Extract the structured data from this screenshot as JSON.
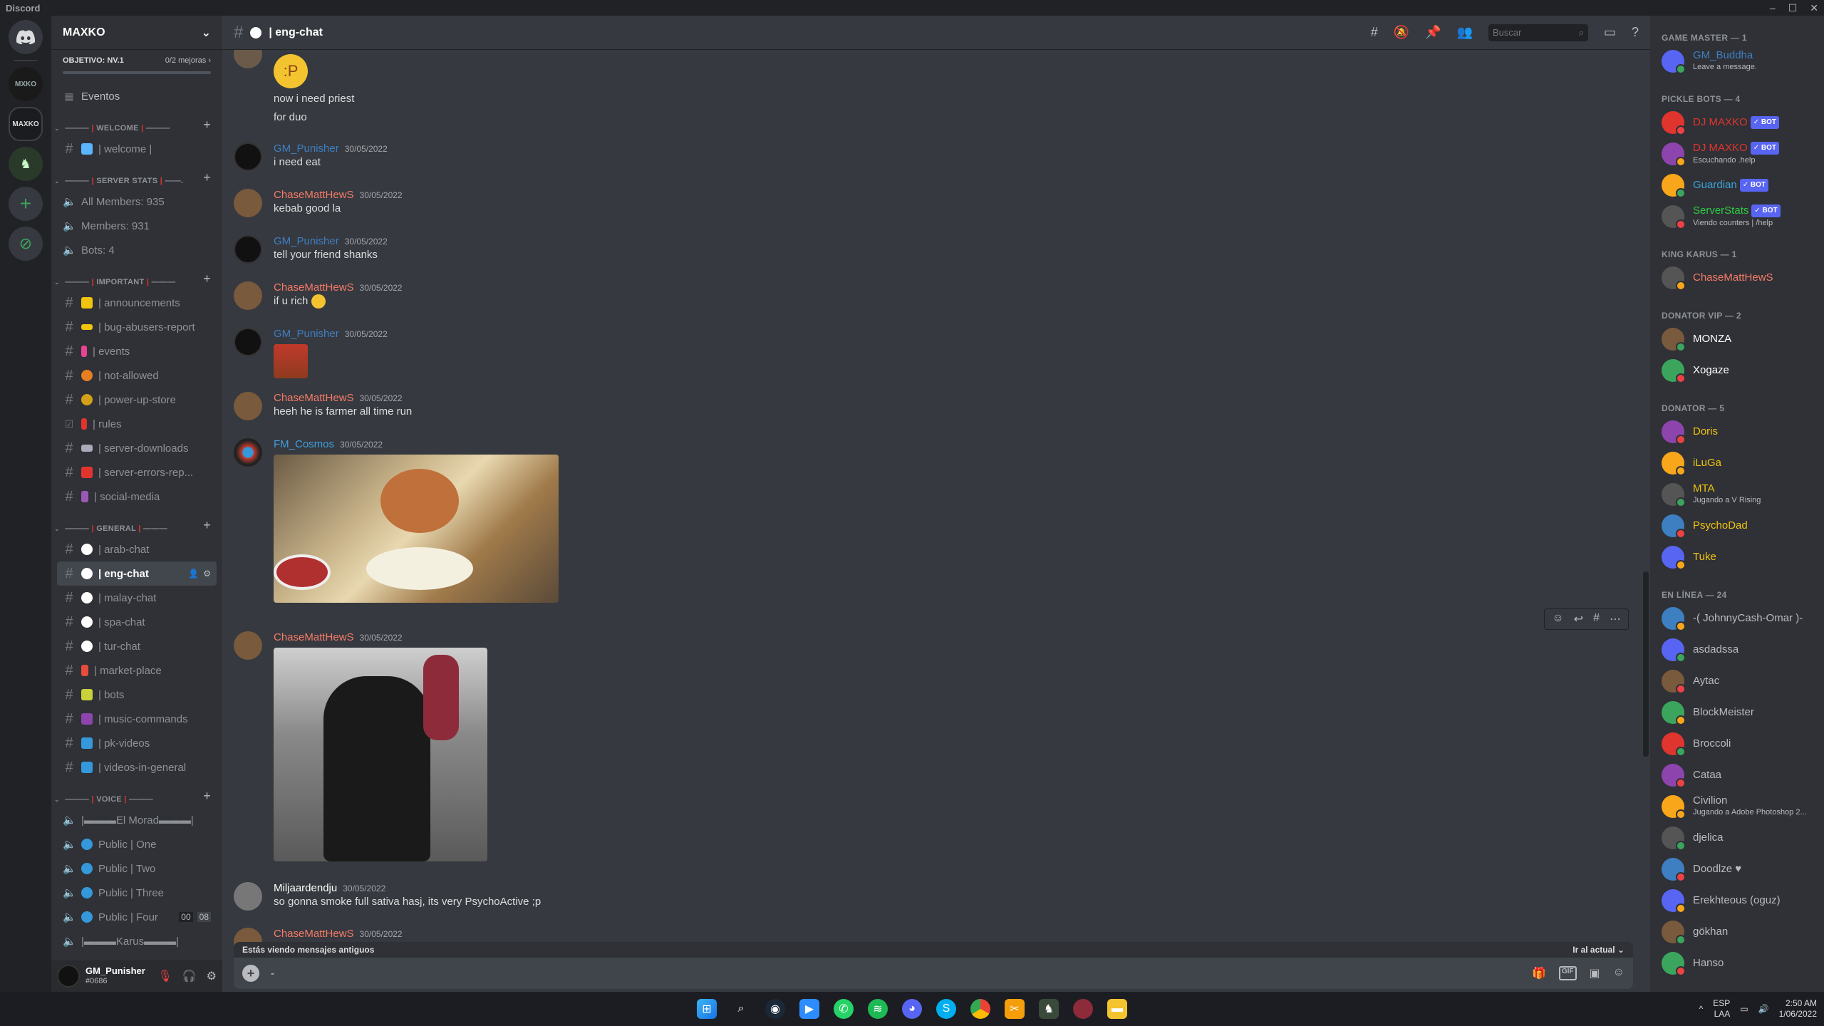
{
  "app": {
    "name": "Discord"
  },
  "server": {
    "name": "MAXKO",
    "boost_goal": "OBJETIVO: NV.1",
    "boost_progress": "0/2 mejoras",
    "boost_fraction": 0.0,
    "events_label": "Eventos"
  },
  "categories": {
    "welcome": "WELCOME",
    "server_stats": "SERVER STATS",
    "important": "IMPORTANT",
    "general": "GENERAL",
    "voice": "VOICE"
  },
  "channels": {
    "welcome": [
      "| welcome |"
    ],
    "server_stats": [
      "All Members: 935",
      "Members: 931",
      "Bots: 4"
    ],
    "important": [
      "| announcements",
      "| bug-abusers-report",
      "| events",
      "| not-allowed",
      "| power-up-store",
      "| rules",
      "| server-downloads",
      "| server-errors-rep...",
      "| social-media"
    ],
    "general": [
      "| arab-chat",
      "| eng-chat",
      "| malay-chat",
      "| spa-chat",
      "| tur-chat",
      "| market-place",
      "| bots",
      "| music-commands",
      "| pk-videos",
      "| videos-in-general"
    ],
    "voice": [
      "|▬▬▬El Morad▬▬▬|",
      "Public | One",
      "Public | Two",
      "Public | Three",
      "Public | Four",
      "|▬▬▬Karus▬▬▬|"
    ],
    "voice_four_counts": [
      "00",
      "08"
    ]
  },
  "user": {
    "name": "GM_Punisher",
    "tag": "#0686"
  },
  "channel_header": {
    "title": "| eng-chat",
    "search_placeholder": "Buscar"
  },
  "messages": {
    "top_lines": [
      "now i need priest",
      "for duo"
    ],
    "m1": {
      "author": "GM_Punisher",
      "time": "30/05/2022",
      "text": "i need eat"
    },
    "m2": {
      "author": "ChaseMattHewS",
      "time": "30/05/2022",
      "text": "kebab good la"
    },
    "m3": {
      "author": "GM_Punisher",
      "time": "30/05/2022",
      "text": "tell your friend shanks"
    },
    "m4": {
      "author": "ChaseMattHewS",
      "time": "30/05/2022",
      "text": "if u rich"
    },
    "m5": {
      "author": "GM_Punisher",
      "time": "30/05/2022"
    },
    "m6": {
      "author": "ChaseMattHewS",
      "time": "30/05/2022",
      "text": "heeh he is farmer all time run"
    },
    "m7": {
      "author": "FM_Cosmos",
      "time": "30/05/2022"
    },
    "m8": {
      "author": "ChaseMattHewS",
      "time": "30/05/2022"
    },
    "m9": {
      "author": "Miljaardendju",
      "time": "30/05/2022",
      "text": "so gonna smoke full sativa hasj, its very PsychoActive ;p"
    },
    "m10": {
      "author": "ChaseMattHewS",
      "time": "30/05/2022"
    }
  },
  "old_messages_bar": {
    "text": "Estás viendo mensajes antiguos",
    "jump": "Ir al actual"
  },
  "composer": {
    "value": "-"
  },
  "member_list": {
    "groups": [
      {
        "title": "GAME MASTER — 1",
        "members": [
          {
            "name": "GM_Buddha",
            "status": "Leave a message.",
            "color": "#3e7fc1",
            "bot": false
          }
        ]
      },
      {
        "title": "PICKLE BOTS — 4",
        "members": [
          {
            "name": "DJ MAXKO",
            "status": "",
            "color": "#e0342f",
            "bot": true
          },
          {
            "name": "DJ MAXKO",
            "status": "Escuchando .help",
            "color": "#e0342f",
            "bot": true
          },
          {
            "name": "Guardian",
            "status": "",
            "color": "#3ba5dc",
            "bot": true
          },
          {
            "name": "ServerStats",
            "status": "Viendo counters | /help",
            "color": "#2ecc40",
            "bot": true
          }
        ]
      },
      {
        "title": "KING KARUS — 1",
        "members": [
          {
            "name": "ChaseMattHewS",
            "status": "",
            "color": "#f47b67",
            "bot": false
          }
        ]
      },
      {
        "title": "DONATOR VIP — 2",
        "members": [
          {
            "name": "MONZA",
            "status": "",
            "color": "#ffffff",
            "bot": false
          },
          {
            "name": "Xogaze",
            "status": "",
            "color": "#ffffff",
            "bot": false
          }
        ]
      },
      {
        "title": "DONATOR — 5",
        "members": [
          {
            "name": "Doris",
            "status": "",
            "color": "#f1c40f",
            "bot": false
          },
          {
            "name": "iLuGa",
            "status": "",
            "color": "#f1c40f",
            "bot": false
          },
          {
            "name": "MTA",
            "status": "Jugando a V Rising",
            "color": "#f1c40f",
            "bot": false
          },
          {
            "name": "PsychoDad",
            "status": "",
            "color": "#f1c40f",
            "bot": false
          },
          {
            "name": "Tuke",
            "status": "",
            "color": "#f1c40f",
            "bot": false
          }
        ]
      },
      {
        "title": "EN LÍNEA — 24",
        "members": [
          {
            "name": "-( JohnnyCash-Omar )-",
            "status": "",
            "color": "#b9bbbe",
            "bot": false
          },
          {
            "name": "asdadssa",
            "status": "",
            "color": "#b9bbbe",
            "bot": false
          },
          {
            "name": "Aytac",
            "status": "",
            "color": "#b9bbbe",
            "bot": false
          },
          {
            "name": "BlockMeister",
            "status": "",
            "color": "#b9bbbe",
            "bot": false
          },
          {
            "name": "Broccoli",
            "status": "",
            "color": "#b9bbbe",
            "bot": false
          },
          {
            "name": "Cataa",
            "status": "",
            "color": "#b9bbbe",
            "bot": false
          },
          {
            "name": "Civilion",
            "status": "Jugando a Adobe Photoshop 2...",
            "color": "#b9bbbe",
            "bot": false
          },
          {
            "name": "djelica",
            "status": "",
            "color": "#b9bbbe",
            "bot": false
          },
          {
            "name": "Doodlze ♥",
            "status": "",
            "color": "#b9bbbe",
            "bot": false
          },
          {
            "name": "Erekhteous (oguz)",
            "status": "",
            "color": "#b9bbbe",
            "bot": false
          },
          {
            "name": "gökhan",
            "status": "",
            "color": "#b9bbbe",
            "bot": false
          },
          {
            "name": "Hanso",
            "status": "",
            "color": "#b9bbbe",
            "bot": false
          }
        ]
      }
    ],
    "bot_label": "✓ BOT"
  },
  "taskbar": {
    "lang": "ESP",
    "region": "LAA",
    "time": "2:50 AM",
    "date": "1/06/2022"
  },
  "colors": {
    "gm": "#3e7fc1",
    "chase": "#f47b67",
    "cosmos": "#3e9fe0",
    "accent": "#5865f2"
  }
}
